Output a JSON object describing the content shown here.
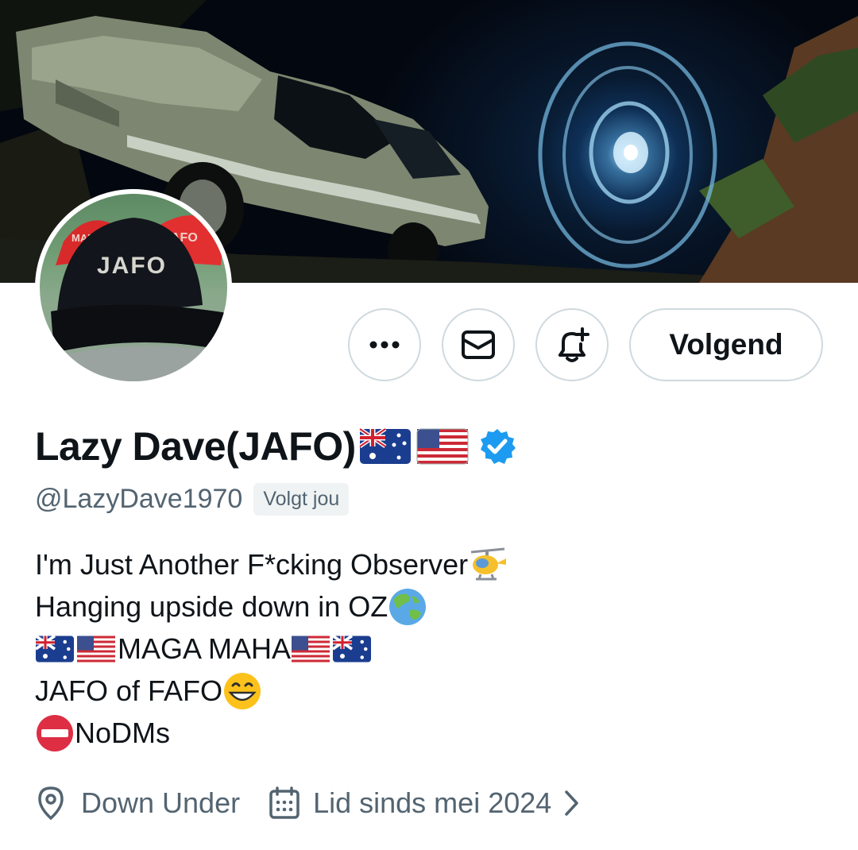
{
  "profile": {
    "display_name": "Lazy Dave(JAFO)",
    "handle": "@LazyDave1970",
    "follows_you_badge": "Volgt jou",
    "verified": true
  },
  "avatar": {
    "cap_text": "JAFO",
    "bg_cap_text_left": "MAFO",
    "bg_cap_text_right": "AFO"
  },
  "actions": {
    "more_icon": "more-horizontal-icon",
    "message_icon": "envelope-icon",
    "notify_icon": "bell-plus-icon",
    "follow_label": "Volgend"
  },
  "bio": {
    "line1": "I'm Just Another F*cking Observer",
    "line2": "Hanging upside down in OZ",
    "line3": "MAGA MAHA",
    "line4": "JAFO of FAFO",
    "line5": "NoDMs"
  },
  "meta": {
    "location": "Down Under",
    "joined": "Lid sinds mei 2024"
  },
  "colors": {
    "verified_blue": "#1d9bf0",
    "secondary_text": "#536471",
    "border": "#cfd9de"
  }
}
